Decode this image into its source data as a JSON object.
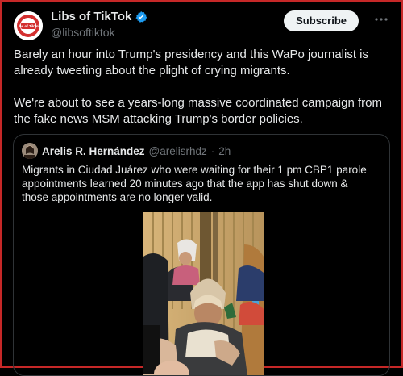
{
  "tweet": {
    "author_name": "Libs of TikTok",
    "author_handle": "@libsoftiktok",
    "avatar_text": "Libs of TikTok",
    "subscribe_label": "Subscribe",
    "more_icon": "ellipsis-icon",
    "paragraphs": [
      "Barely an hour into Trump's presidency and this WaPo journalist is already tweeting about the plight of crying migrants.",
      "We're about to see a years-long massive coordinated campaign from the fake news MSM attacking Trump's border policies."
    ]
  },
  "quoted": {
    "author_name": "Arelis R. Hernández",
    "author_handle": "@arelisrhdz",
    "separator": "·",
    "time": "2h",
    "text": "Migrants in Ciudad Juárez who were waiting for their 1 pm CBP1 parole appointments learned 20 minutes ago that the app has shut down & those appointments are no longer valid."
  },
  "colors": {
    "accent": "#1d9bf0",
    "brand_red": "#d32f2f",
    "border": "#2f3336"
  }
}
